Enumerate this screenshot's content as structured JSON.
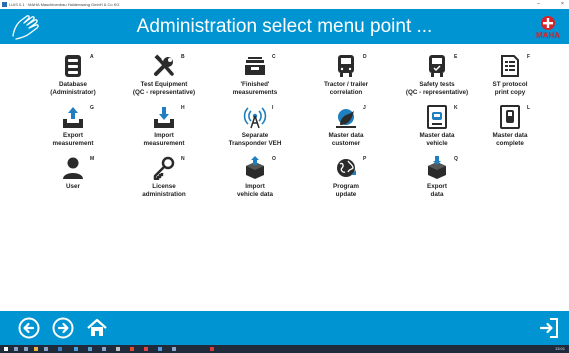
{
  "window": {
    "title": "LUIS 0.1 · MAHA Maschinenbau Haldenwang GmbH & Co KG"
  },
  "header": {
    "title": "Administration select menu point ..."
  },
  "tiles": [
    {
      "key": "A",
      "line1": "Database",
      "line2": "(Administrator)",
      "icon": "database-icon"
    },
    {
      "key": "B",
      "line1": "Test Equipment",
      "line2": "(QC - representative)",
      "icon": "tools-icon"
    },
    {
      "key": "C",
      "line1": "'Finished'",
      "line2": "measurements",
      "icon": "tray-icon"
    },
    {
      "key": "D",
      "line1": "Tractor / trailer",
      "line2": "correlation",
      "icon": "truck-icon"
    },
    {
      "key": "E",
      "line1": "Safety tests",
      "line2": "(QC - representative)",
      "icon": "truck-check-icon"
    },
    {
      "key": "F",
      "line1": "ST protocol",
      "line2": "print copy",
      "icon": "document-icon"
    },
    {
      "key": "G",
      "line1": "Export",
      "line2": "measurement",
      "icon": "export-tray-icon"
    },
    {
      "key": "H",
      "line1": "Import",
      "line2": "measurement",
      "icon": "import-tray-icon"
    },
    {
      "key": "I",
      "line1": "Separate",
      "line2": "Transponder VEH",
      "icon": "transponder-icon"
    },
    {
      "key": "J",
      "line1": "Master data",
      "line2": "customer",
      "icon": "customer-icon"
    },
    {
      "key": "K",
      "line1": "Master data",
      "line2": "vehicle",
      "icon": "vehicle-card-icon"
    },
    {
      "key": "L",
      "line1": "Master data",
      "line2": "complete",
      "icon": "data-complete-icon"
    },
    {
      "key": "M",
      "line1": "User",
      "line2": "",
      "icon": "user-icon"
    },
    {
      "key": "N",
      "line1": "License",
      "line2": "administration",
      "icon": "key-icon"
    },
    {
      "key": "O",
      "line1": "Import",
      "line2": "vehicle data",
      "icon": "box-import-icon"
    },
    {
      "key": "P",
      "line1": "Program",
      "line2": "update",
      "icon": "globe-update-icon"
    },
    {
      "key": "Q",
      "line1": "Export",
      "line2": "data",
      "icon": "box-export-icon"
    }
  ],
  "footer": {
    "back": "back-icon",
    "forward": "forward-icon",
    "home": "home-icon",
    "exit": "exit-icon"
  },
  "taskbar": {
    "clock": "13:01"
  },
  "colors": {
    "accent": "#0095d2",
    "icon": "#2b2b2b",
    "icon_blue": "#1f7fc0",
    "logo_red": "#d6222a"
  }
}
